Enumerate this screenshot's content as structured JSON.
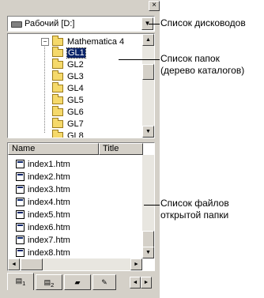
{
  "panel": {
    "close_glyph": "×",
    "drive_combo": {
      "value": "Рабочий [D:]",
      "dropdown_glyph": "▼"
    },
    "tree": {
      "root_node": "Mathematica 4",
      "selected": "GL1",
      "folders": [
        "GL2",
        "GL3",
        "GL4",
        "GL5",
        "GL6",
        "GL7",
        "GL8"
      ]
    },
    "files": {
      "columns": [
        "Name",
        "Title"
      ],
      "items": [
        "index1.htm",
        "index2.htm",
        "index3.htm",
        "index4.htm",
        "index5.htm",
        "index6.htm",
        "index7.htm",
        "index8.htm"
      ]
    },
    "tabs": [
      "1",
      "2",
      "",
      ""
    ],
    "scroll_glyphs": {
      "up": "▲",
      "down": "▼",
      "left": "◄",
      "right": "►"
    }
  },
  "callouts": {
    "drives": "Список дисководов",
    "folders": "Список папок\n(дерево каталогов)",
    "files": "Список файлов\nоткрытой папки"
  }
}
